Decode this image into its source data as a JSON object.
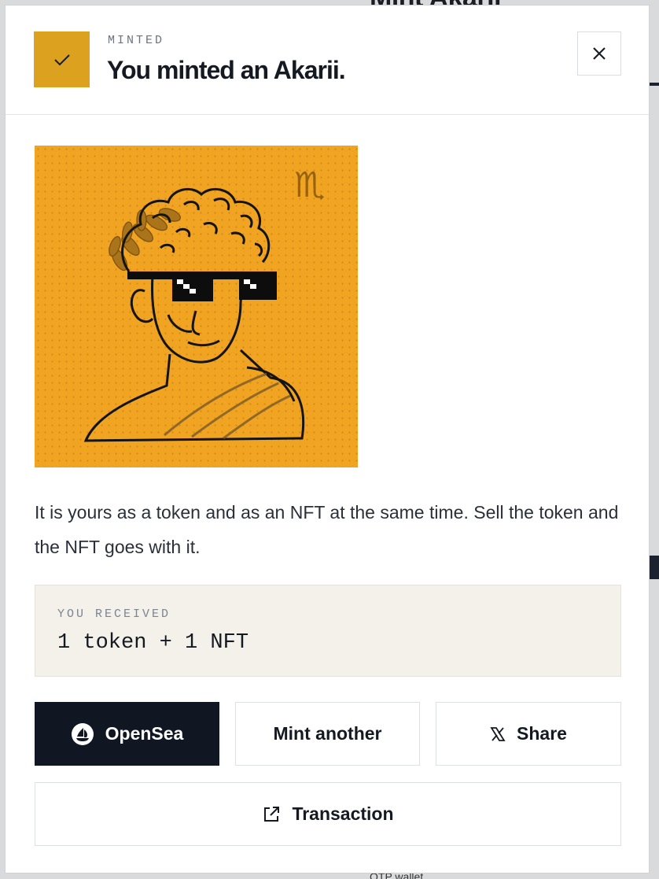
{
  "background": {
    "heading": "Mint Akarii",
    "footer_text": "OTP wallet"
  },
  "modal": {
    "kicker": "MINTED",
    "title": "You minted an Akarii.",
    "check_icon": "check-icon",
    "close_icon": "close-icon"
  },
  "nft": {
    "zodiac_symbol": "♏",
    "background_color": "#f0a422",
    "image_subject": "classical bust wearing pixel sunglasses and laurel wreath"
  },
  "description": "It is yours as a token and as an NFT at the same time. Sell the token and the NFT goes with it.",
  "received": {
    "label": "YOU RECEIVED",
    "value": "1 token + 1 NFT"
  },
  "actions": {
    "opensea_label": "OpenSea",
    "mint_another_label": "Mint another",
    "share_label": "Share",
    "transaction_label": "Transaction"
  },
  "colors": {
    "accent": "#dca11f",
    "primary_button": "#111722",
    "received_bg": "#f3f1ea"
  }
}
